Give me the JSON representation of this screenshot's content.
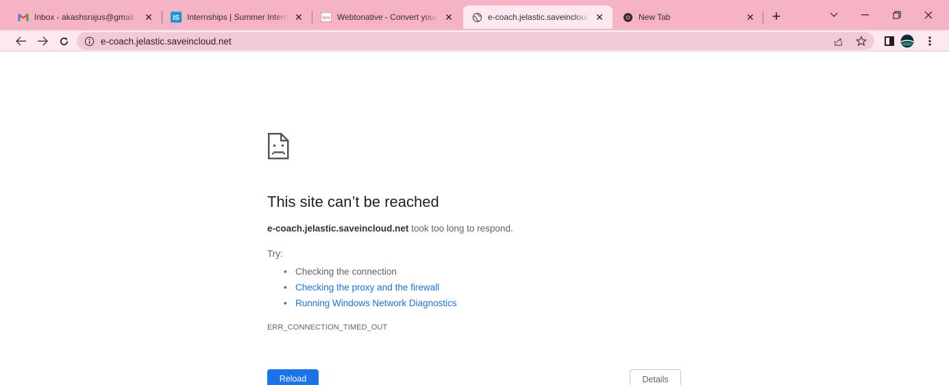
{
  "tabs": [
    {
      "title": "Inbox - akashsrajus@gmail.com",
      "favicon": "gmail-icon",
      "close": "✕"
    },
    {
      "title": "Internships | Summer Internships",
      "favicon": "internshala-icon",
      "close": "✕"
    },
    {
      "title": "Webtonative - Convert your website",
      "favicon": "webtonative-icon",
      "close": "✕"
    },
    {
      "title": "e-coach.jelastic.saveincloud.net",
      "favicon": "globe-icon",
      "close": "✕",
      "active": true
    },
    {
      "title": "New Tab",
      "favicon": "chrome-icon",
      "close": "✕"
    }
  ],
  "tabstrip": {
    "new_tab": "+",
    "tab_search": "⌄",
    "minimize": "–",
    "restore": "❐",
    "window_close": "✕"
  },
  "toolbar": {
    "back": "←",
    "forward": "→",
    "reload": "C",
    "url": "e-coach.jelastic.saveincloud.net",
    "icons": [
      "share-icon",
      "bookmark-star-icon",
      "side-panel-icon",
      "profile-avatar-icon",
      "menu-dots-icon"
    ]
  },
  "error_page": {
    "heading": "This site can’t be reached",
    "host": "e-coach.jelastic.saveincloud.net",
    "summary_rest": " took too long to respond.",
    "try_label": "Try:",
    "suggestions": [
      "Checking the connection",
      "Checking the proxy and the firewall",
      "Running Windows Network Diagnostics"
    ],
    "error_code": "ERR_CONNECTION_TIMED_OUT",
    "reload_label": "Reload",
    "details_label": "Details"
  },
  "colors": {
    "tabstrip_bg": "#f5b4c3",
    "toolbar_bg": "#fce8ee",
    "link": "#1a73e8",
    "button_primary": "#1a73e8"
  }
}
